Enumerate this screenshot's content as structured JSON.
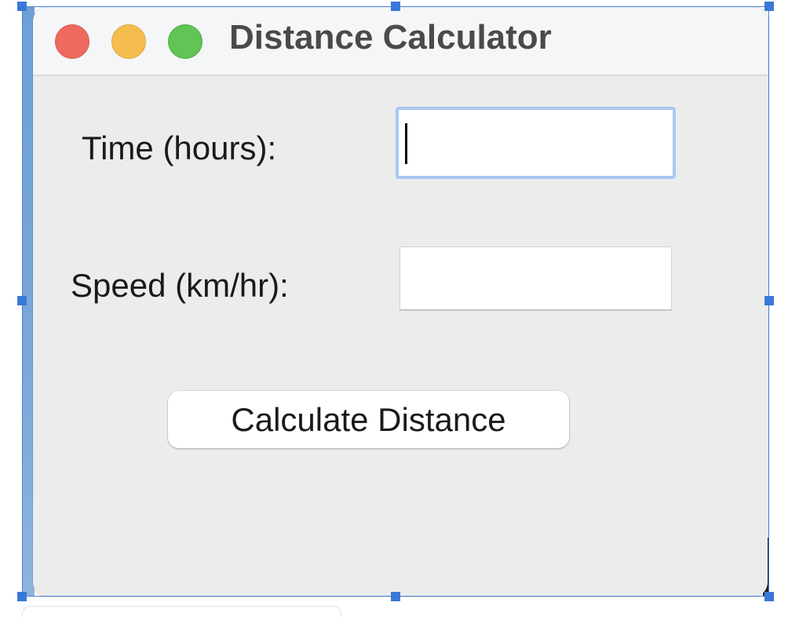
{
  "window": {
    "title": "Distance Calculator"
  },
  "form": {
    "time_label": "Time (hours):",
    "time_value": "",
    "speed_label": "Speed (km/hr):",
    "speed_value": "",
    "calculate_button": "Calculate Distance"
  },
  "icons": {
    "close": "close-button-red",
    "minimize": "minimize-button-yellow",
    "maximize": "zoom-button-green"
  },
  "colors": {
    "close": "#ee6a5f",
    "minimize": "#f5bd4f",
    "maximize": "#61c454",
    "focus_ring": "#a9c8f3",
    "selection_handles": "#3a78d8"
  }
}
